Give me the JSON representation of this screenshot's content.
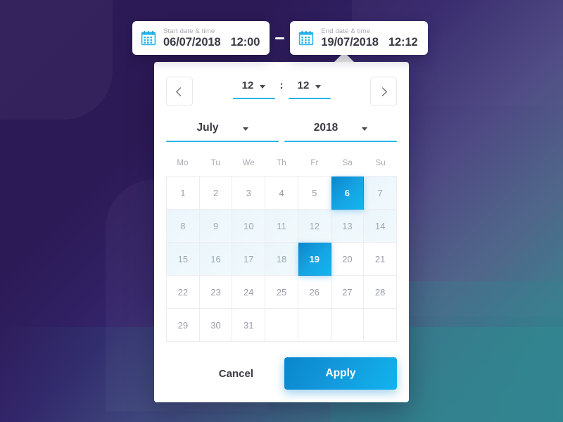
{
  "range_fields": {
    "separator": "–",
    "start": {
      "icon": "calendar-icon",
      "label": "Start date & time",
      "date": "06/07/2018",
      "time": "12:00"
    },
    "end": {
      "icon": "calendar-icon",
      "label": "End date & time",
      "date": "19/07/2018",
      "time": "12:12"
    }
  },
  "picker": {
    "prev_icon": "chevron-left-icon",
    "next_icon": "chevron-right-icon",
    "time": {
      "hour": "12",
      "minute": "12",
      "colon": ":",
      "caret_icon": "chevron-down-icon"
    },
    "month": "July",
    "year": "2018",
    "weekdays": [
      "Mo",
      "Tu",
      "We",
      "Th",
      "Fr",
      "Sa",
      "Su"
    ],
    "weeks": [
      [
        {
          "d": "1",
          "state": "normal"
        },
        {
          "d": "2",
          "state": "normal"
        },
        {
          "d": "3",
          "state": "normal"
        },
        {
          "d": "4",
          "state": "normal"
        },
        {
          "d": "5",
          "state": "normal"
        },
        {
          "d": "6",
          "state": "selected"
        },
        {
          "d": "7",
          "state": "in-range"
        }
      ],
      [
        {
          "d": "8",
          "state": "in-range"
        },
        {
          "d": "9",
          "state": "in-range"
        },
        {
          "d": "10",
          "state": "in-range"
        },
        {
          "d": "11",
          "state": "in-range"
        },
        {
          "d": "12",
          "state": "in-range"
        },
        {
          "d": "13",
          "state": "in-range"
        },
        {
          "d": "14",
          "state": "in-range"
        }
      ],
      [
        {
          "d": "15",
          "state": "in-range"
        },
        {
          "d": "16",
          "state": "in-range"
        },
        {
          "d": "17",
          "state": "in-range"
        },
        {
          "d": "18",
          "state": "in-range"
        },
        {
          "d": "19",
          "state": "selected"
        },
        {
          "d": "20",
          "state": "normal"
        },
        {
          "d": "21",
          "state": "normal"
        }
      ],
      [
        {
          "d": "22",
          "state": "normal"
        },
        {
          "d": "23",
          "state": "normal"
        },
        {
          "d": "24",
          "state": "normal"
        },
        {
          "d": "25",
          "state": "normal"
        },
        {
          "d": "26",
          "state": "normal"
        },
        {
          "d": "27",
          "state": "normal"
        },
        {
          "d": "28",
          "state": "normal"
        }
      ],
      [
        {
          "d": "29",
          "state": "normal"
        },
        {
          "d": "30",
          "state": "normal"
        },
        {
          "d": "31",
          "state": "normal"
        },
        {
          "d": "",
          "state": "empty"
        },
        {
          "d": "",
          "state": "empty"
        },
        {
          "d": "",
          "state": "empty"
        },
        {
          "d": "",
          "state": "empty"
        }
      ]
    ],
    "cancel_label": "Cancel",
    "apply_label": "Apply"
  },
  "colors": {
    "accent": "#12b5ef",
    "accent_dark": "#0a86cd",
    "underline": "#27b4e8",
    "range_bg": "#eaf5fb",
    "text_dark": "#3b3b45",
    "text_muted": "#a9a9b3",
    "background_purple": "#2d1b58",
    "background_teal": "#2f7f8e"
  }
}
